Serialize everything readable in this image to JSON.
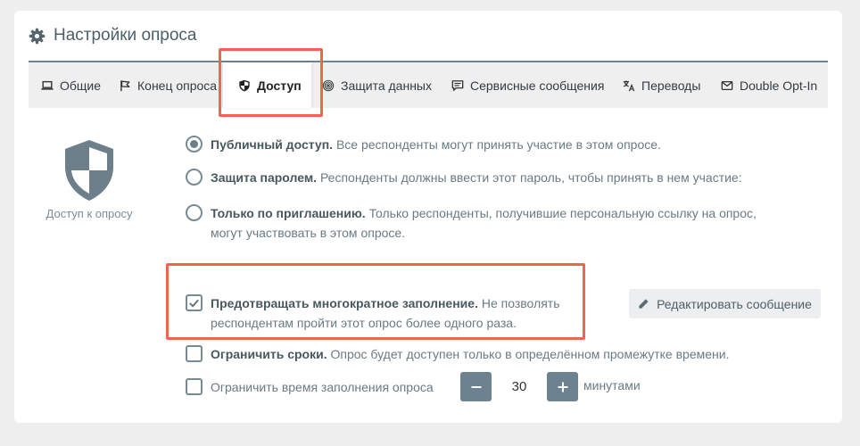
{
  "header": {
    "title": "Настройки опроса",
    "icon": "gear-icon"
  },
  "tabs": [
    {
      "label": "Общие",
      "icon": "laptop-icon"
    },
    {
      "label": "Конец опроса",
      "icon": "flag-icon"
    },
    {
      "label": "Доступ",
      "icon": "shield-icon",
      "active": true
    },
    {
      "label": "Защита данных",
      "icon": "fingerprint-icon"
    },
    {
      "label": "Сервисные сообщения",
      "icon": "message-icon"
    },
    {
      "label": "Переводы",
      "icon": "translate-icon"
    },
    {
      "label": "Double Opt-In",
      "icon": "envelope-icon"
    }
  ],
  "sidebar": {
    "label": "Доступ к опросу",
    "icon": "shield-icon"
  },
  "access_options": [
    {
      "title": "Публичный доступ.",
      "desc": " Все респонденты могут принять участие в этом опросе.",
      "selected": true
    },
    {
      "title": "Защита паролем.",
      "desc": " Респонденты должны ввести этот пароль, чтобы принять в нем участие:",
      "selected": false
    },
    {
      "title": "Только по приглашению.",
      "desc": " Только респонденты, получившие персональную ссылку на опрос,",
      "desc2": "могут участвовать в этом опросе.",
      "selected": false
    }
  ],
  "prevent_multiple": {
    "title": "Предотвращать многократное заполнение.",
    "desc": " Не позволять",
    "desc2": "респондентам пройти этот опрос более одного раза.",
    "checked": true
  },
  "edit_message_button": "Редактировать сообщение",
  "limit_dates": {
    "title": "Ограничить сроки.",
    "desc": " Опрос будет доступен только в определённом промежутке времени.",
    "checked": false
  },
  "limit_time": {
    "label": "Ограничить время заполнения опроса",
    "value": "30",
    "unit": "минутами",
    "checked": false
  },
  "colors": {
    "accent": "#6d8290",
    "highlight": "#f06455",
    "text": "#4a5a63"
  }
}
